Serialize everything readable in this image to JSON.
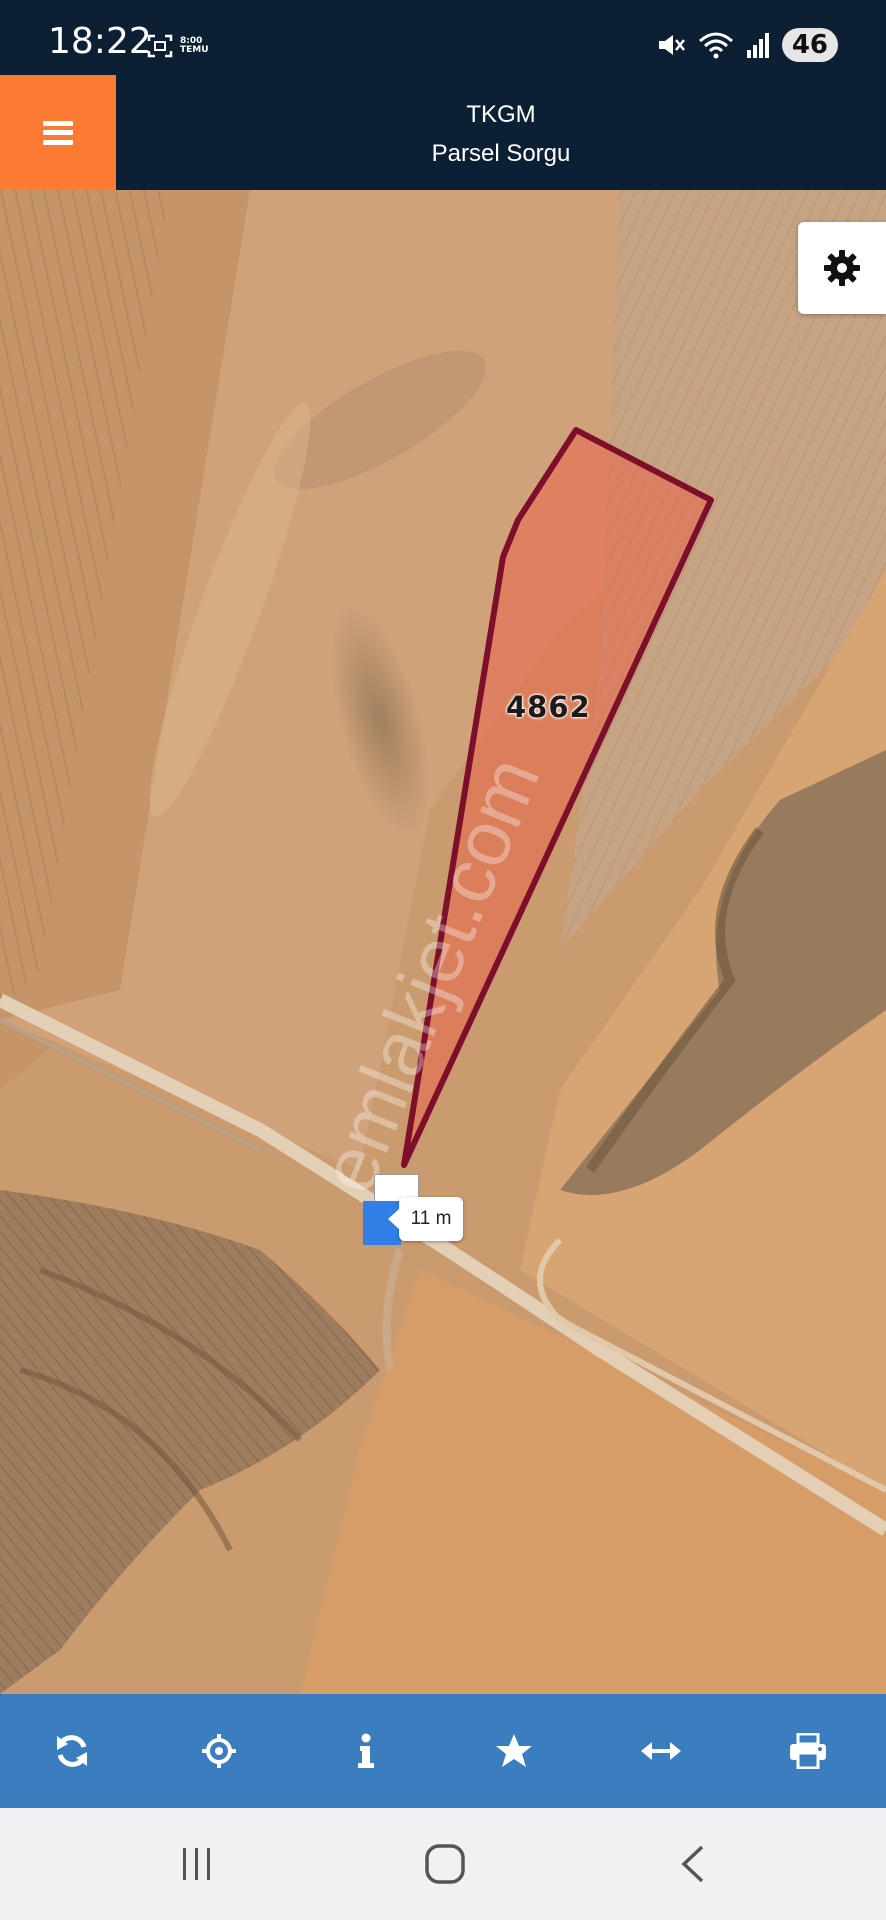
{
  "status_bar": {
    "time": "18:22",
    "temu_label_1": "8:00",
    "temu_label_2": "TEMU",
    "battery": "46"
  },
  "header": {
    "title": "TKGM",
    "subtitle": "Parsel Sorgu",
    "accent_color": "#fc7b33",
    "background_color": "#0c2035"
  },
  "map": {
    "parcel_number": "4862",
    "parcel_fill_color": "#e86a4e",
    "parcel_stroke_color": "#7d0f2a",
    "scale_label": "11 m",
    "watermark": "emlakjet.com"
  },
  "toolbar": {
    "background_color": "#3a7ec0",
    "icons": [
      "refresh-icon",
      "locate-icon",
      "info-icon",
      "star-icon",
      "measure-icon",
      "print-icon"
    ]
  },
  "nav_bar": {
    "icons": [
      "recent-apps-icon",
      "home-icon",
      "back-icon"
    ]
  }
}
